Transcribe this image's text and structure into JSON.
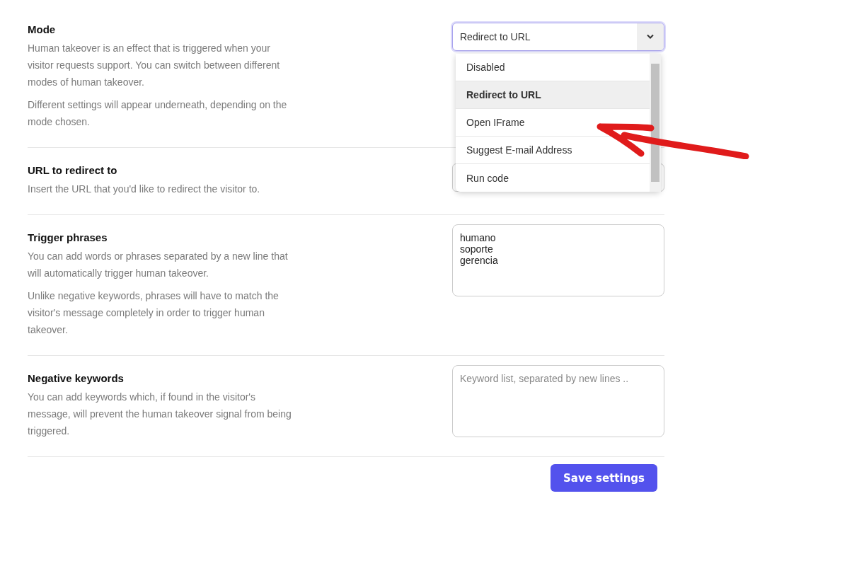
{
  "sections": [
    {
      "kind": "select",
      "title": "Mode",
      "paragraphs": [
        "Human takeover is an effect that is triggered when your visitor requests support. You can switch between different modes of human takeover.",
        "Different settings will appear underneath, depending on the mode chosen."
      ],
      "value": "Redirect to URL",
      "expanded": true,
      "options": [
        {
          "label": "Disabled",
          "selected": false
        },
        {
          "label": "Redirect to URL",
          "selected": true
        },
        {
          "label": "Open IFrame",
          "selected": false
        },
        {
          "label": "Suggest E-mail Address",
          "selected": false
        },
        {
          "label": "Run code",
          "selected": false
        }
      ]
    },
    {
      "kind": "input",
      "title": "URL to redirect to",
      "paragraphs": [
        "Insert the URL that you'd like to redirect the visitor to."
      ]
    },
    {
      "kind": "textarea",
      "title": "Trigger phrases",
      "paragraphs": [
        "You can add words or phrases separated by a new line that will automatically trigger human takeover.",
        "Unlike negative keywords, phrases will have to match the visitor's message completely in order to trigger human takeover."
      ],
      "value": "humano\nsoporte\ngerencia"
    },
    {
      "kind": "textarea",
      "title": "Negative keywords",
      "paragraphs": [
        "You can add keywords which, if found in the visitor's message, will prevent the human takeover signal from being triggered."
      ],
      "placeholder": "Keyword list, separated by new lines .."
    }
  ],
  "save_button": "Save settings"
}
